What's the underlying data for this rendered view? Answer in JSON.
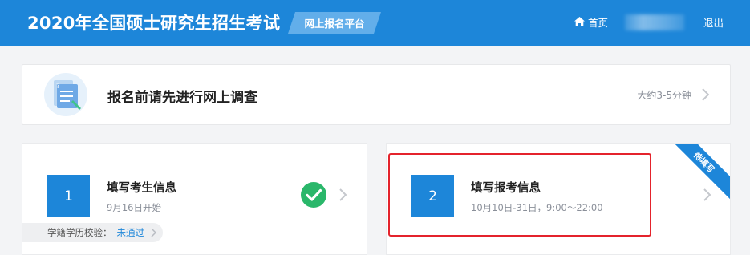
{
  "header": {
    "title": "2020年全国硕士研究生招生考试",
    "platform": "网上报名平台",
    "home_label": "首页",
    "logout_label": "退出",
    "home_icon": "home-icon"
  },
  "survey": {
    "title": "报名前请先进行网上调查",
    "duration": "大约3-5分钟",
    "icon": "questionnaire-illustration"
  },
  "steps": [
    {
      "number": "1",
      "title": "填写考生信息",
      "subtitle": "9月16日开始",
      "status_icon": "check-icon",
      "verify_label": "学籍学历校验：",
      "verify_status": "未通过"
    },
    {
      "number": "2",
      "title": "填写报考信息",
      "subtitle": "10月10日-31日，9:00～22:00",
      "ribbon": "待填写"
    }
  ],
  "colors": {
    "brand": "#1d86d9",
    "success": "#2ab76a",
    "highlight": "#e4232c"
  }
}
